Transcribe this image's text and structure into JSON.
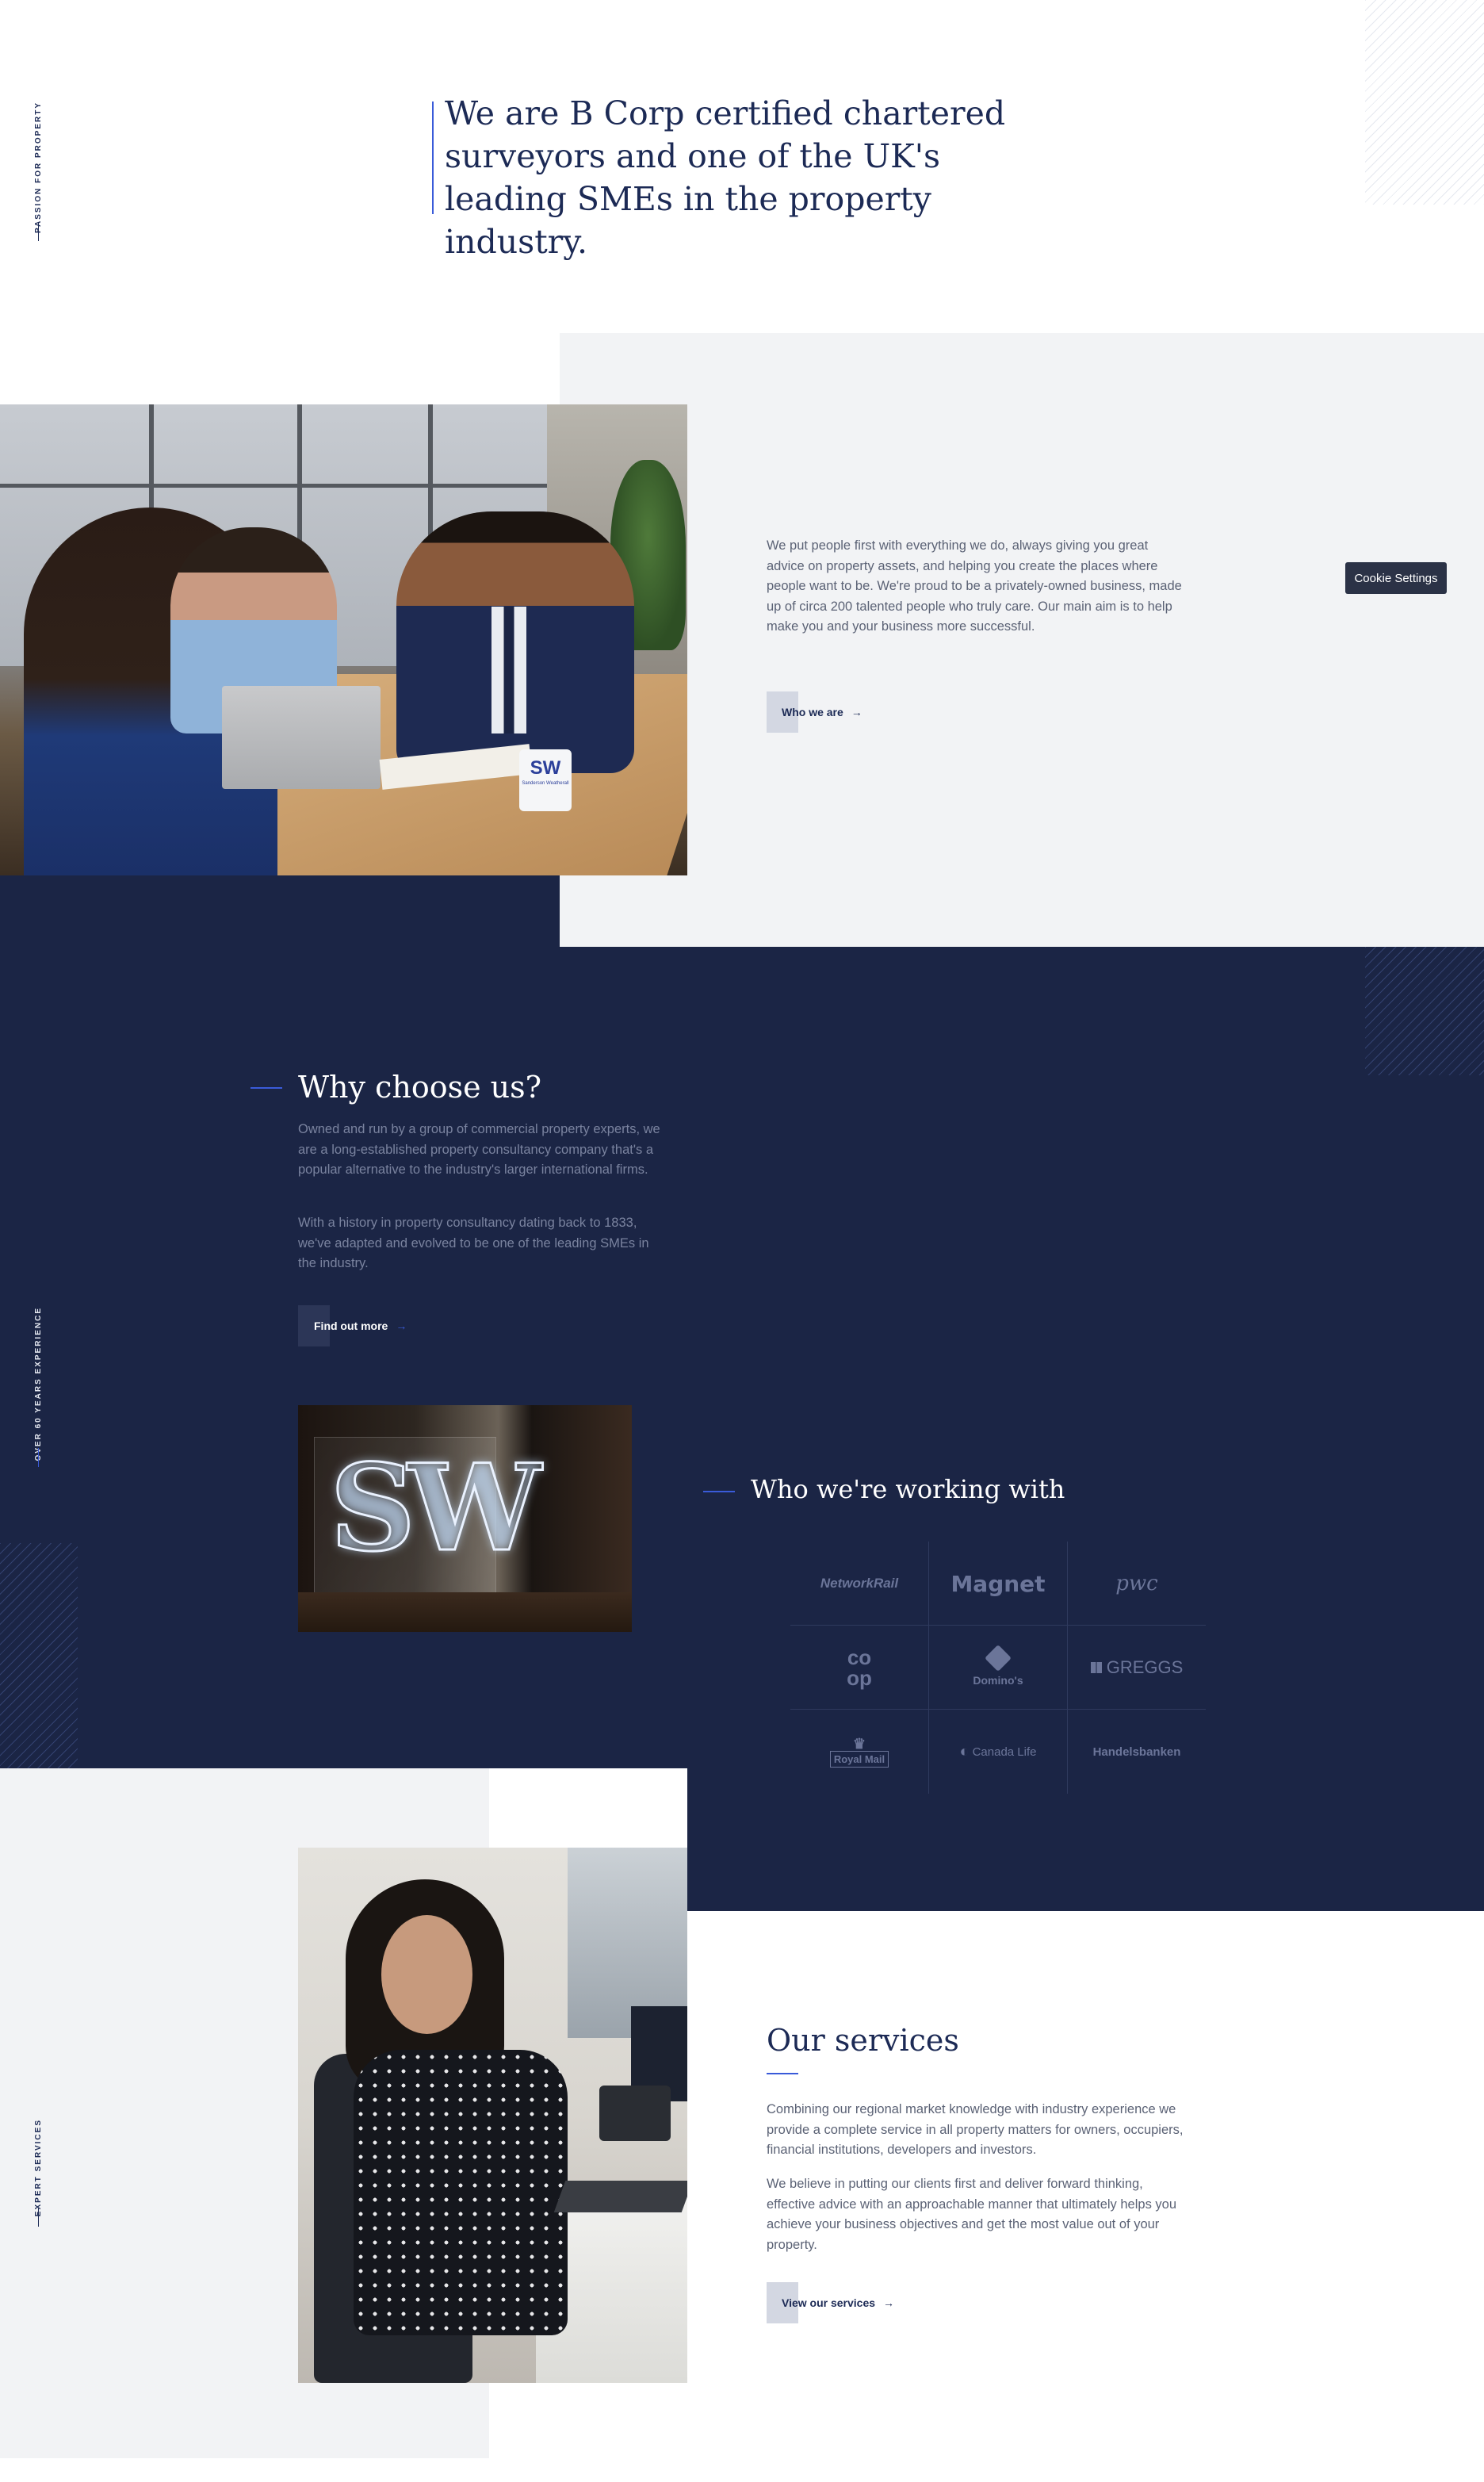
{
  "hero": {
    "side_label": "Passion for property",
    "heading": "We are B Corp certified chartered surveyors and one of the UK's leading SMEs in the property industry."
  },
  "intro": {
    "text": "We put people first with everything we do, always giving you great advice on property assets, and helping you create the places where people want to be. We're proud to be a privately-owned business, made up of circa 200 talented people who truly care. Our main aim is to help make you and your business more successful.",
    "button_label": "Who we are",
    "mug_logo": "SW",
    "mug_text": "Sanderson Weatherall"
  },
  "cookie": {
    "label": "Cookie Settings"
  },
  "why": {
    "side_label": "Over 60 years experience",
    "heading": "Why choose us?",
    "paragraph_1": "Owned and run by a group of commercial property experts, we are a long-established property consultancy company that's a popular alternative to the industry's larger international firms.",
    "paragraph_2": "With a history in property consultancy dating back to 1833, we've adapted and evolved to be one of the leading SMEs in the industry.",
    "button_label": "Find out more",
    "neon_sign": "SW"
  },
  "partners": {
    "heading": "Who we're working with",
    "logos": [
      "NetworkRail",
      "Magnet",
      "pwc",
      "co op",
      "Domino's",
      "GREGGS",
      "Royal Mail",
      "Canada Life",
      "Handelsbanken"
    ]
  },
  "services": {
    "side_label": "Expert services",
    "heading": "Our services",
    "paragraph_1": "Combining our regional market knowledge with industry experience we provide a complete service in all property matters for owners, occupiers, financial institutions, developers and investors.",
    "paragraph_2": "We believe in putting our clients first and deliver forward thinking, effective advice with an approachable manner that ultimately helps you achieve your business objectives and get the most value out of your property.",
    "button_label": "View our services"
  },
  "icons": {
    "arrow": "arrow-right-icon"
  },
  "colors": {
    "navy": "#1b2545",
    "heading_navy": "#1c2a55",
    "light_gray": "#f2f3f5",
    "accent_blue": "#3a5bd9",
    "button_tab": "#d3d7e2"
  }
}
